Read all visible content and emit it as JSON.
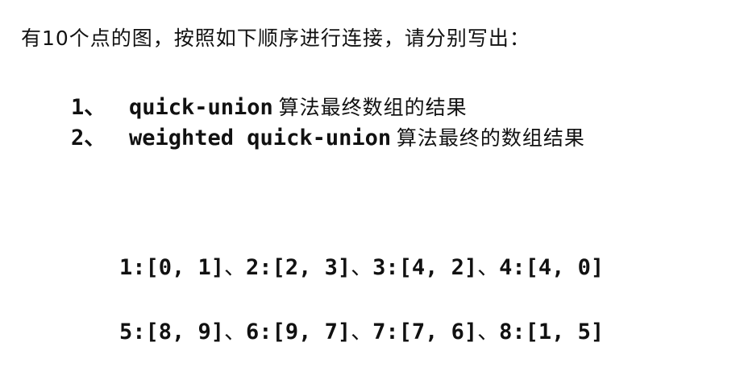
{
  "intro": "有10个点的图，按照如下顺序进行连接，请分别写出：",
  "tasks": [
    {
      "num": "1、",
      "algorithm": "quick-union",
      "suffix": "算法最终数组的结果"
    },
    {
      "num": "2、",
      "algorithm": "weighted quick-union",
      "suffix": "算法最终的数组结果"
    }
  ],
  "separator": "、",
  "connections": [
    "1:[0, 1]",
    "2:[2, 3]",
    "3:[4, 2]",
    "4:[4, 0]",
    "5:[8, 9]",
    "6:[9, 7]",
    "7:[7, 6]",
    "8:[1, 5]"
  ]
}
